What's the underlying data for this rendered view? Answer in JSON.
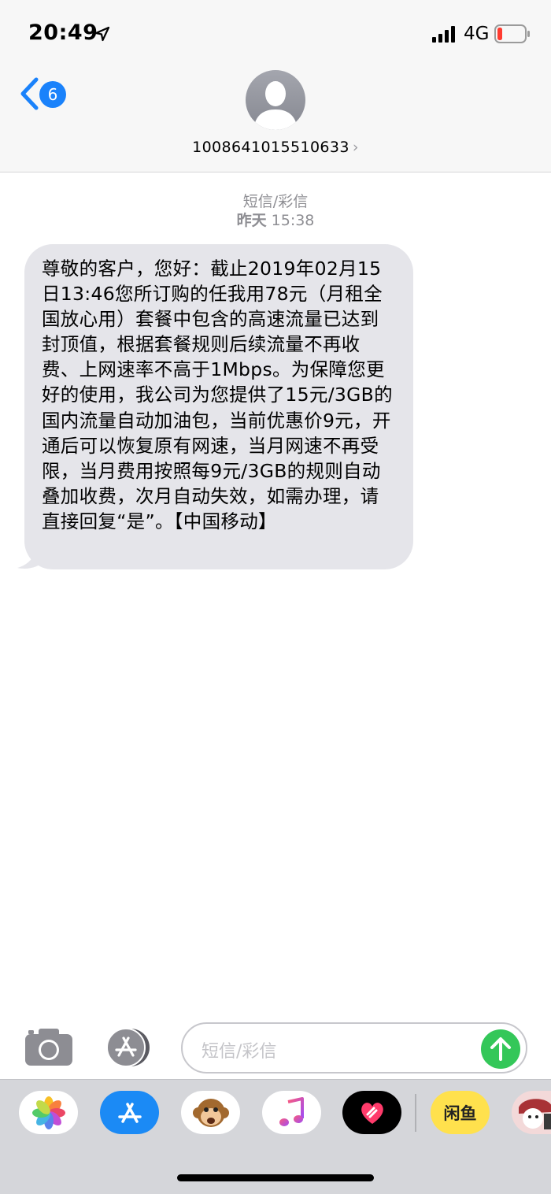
{
  "status_bar": {
    "time": "20:49",
    "network": "4G"
  },
  "header": {
    "back_badge_count": "6",
    "contact_number": "1008641015510633",
    "contact_chevron": "›"
  },
  "conversation": {
    "service_label": "短信/彩信",
    "timestamp_day": "昨天",
    "timestamp_time": "15:38",
    "messages": [
      {
        "direction": "incoming",
        "text": "尊敬的客户，您好：截止2019年02月15日13:46您所订购的任我用78元（月租全国放心用）套餐中包含的高速流量已达到封顶值，根据套餐规则后续流量不再收费、上网速率不高于1Mbps。为保障您更好的使用，我公司为您提供了15元/3GB的国内流量自动加油包，当前优惠价9元，开通后可以恢复原有网速，当月网速不再受限，当月费用按照每9元/3GB的规则自动叠加收费，次月自动失效，如需办理，请直接回复“是”。【中国移动】"
      }
    ]
  },
  "input_bar": {
    "placeholder": "短信/彩信"
  },
  "app_drawer": {
    "apps": [
      "photos-icon",
      "app-store-icon",
      "animoji-icon",
      "music-icon",
      "digital-touch-icon",
      "xianyu-icon",
      "sticker-icon"
    ],
    "xianyu_label": "闲鱼"
  },
  "colors": {
    "accent_blue": "#1a82fb",
    "bubble_gray": "#e5e5ea",
    "send_green": "#34c759",
    "battery_low": "#ff3b30"
  }
}
